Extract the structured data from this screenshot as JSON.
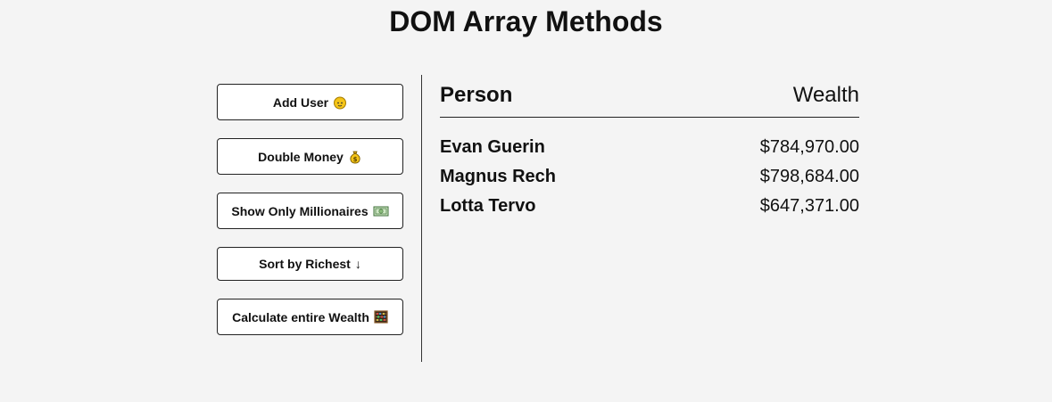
{
  "page": {
    "title": "DOM Array Methods"
  },
  "buttons": [
    {
      "label": "Add User",
      "icon": "face-icon"
    },
    {
      "label": "Double Money",
      "icon": "money-bag-icon"
    },
    {
      "label": "Show Only Millionaires",
      "icon": "dollar-bill-icon"
    },
    {
      "label": "Sort by Richest",
      "icon": "down-arrow-icon",
      "glyph": "↓"
    },
    {
      "label": "Calculate entire Wealth",
      "icon": "abacus-icon"
    }
  ],
  "table": {
    "header_person": "Person",
    "header_wealth": "Wealth",
    "rows": [
      {
        "name": "Evan Guerin",
        "wealth": "$784,970.00"
      },
      {
        "name": "Magnus Rech",
        "wealth": "$798,684.00"
      },
      {
        "name": "Lotta Tervo",
        "wealth": "$647,371.00"
      }
    ]
  },
  "colors": {
    "background": "#f4f4f4",
    "button_bg": "#ffffff",
    "border": "#222222",
    "emoji_yellow": "#f5c518"
  }
}
